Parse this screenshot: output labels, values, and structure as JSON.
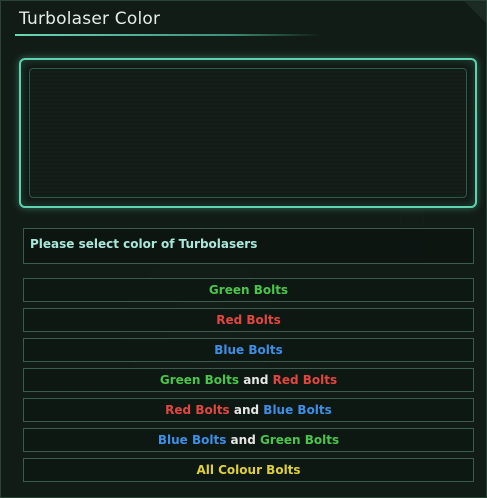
{
  "window": {
    "title": "Turbolaser Color"
  },
  "prompt": {
    "text": "Please select color of Turbolasers"
  },
  "connector": " and ",
  "options": [
    {
      "parts": [
        {
          "text": "Green Bolts",
          "color": "green"
        }
      ]
    },
    {
      "parts": [
        {
          "text": "Red Bolts",
          "color": "red"
        }
      ]
    },
    {
      "parts": [
        {
          "text": "Blue Bolts",
          "color": "blue"
        }
      ]
    },
    {
      "parts": [
        {
          "text": "Green Bolts",
          "color": "green"
        },
        {
          "text": "Red Bolts",
          "color": "red"
        }
      ]
    },
    {
      "parts": [
        {
          "text": "Red Bolts",
          "color": "red"
        },
        {
          "text": "Blue Bolts",
          "color": "blue"
        }
      ]
    },
    {
      "parts": [
        {
          "text": "Blue Bolts",
          "color": "blue"
        },
        {
          "text": "Green Bolts",
          "color": "green"
        }
      ]
    },
    {
      "parts": [
        {
          "text": "All Colour Bolts",
          "color": "yellow"
        }
      ]
    }
  ],
  "colors": {
    "green": "#4ac54a",
    "red": "#e2473f",
    "blue": "#3f8ee6",
    "yellow": "#e0cf3c",
    "accent": "#5fd3b0"
  }
}
